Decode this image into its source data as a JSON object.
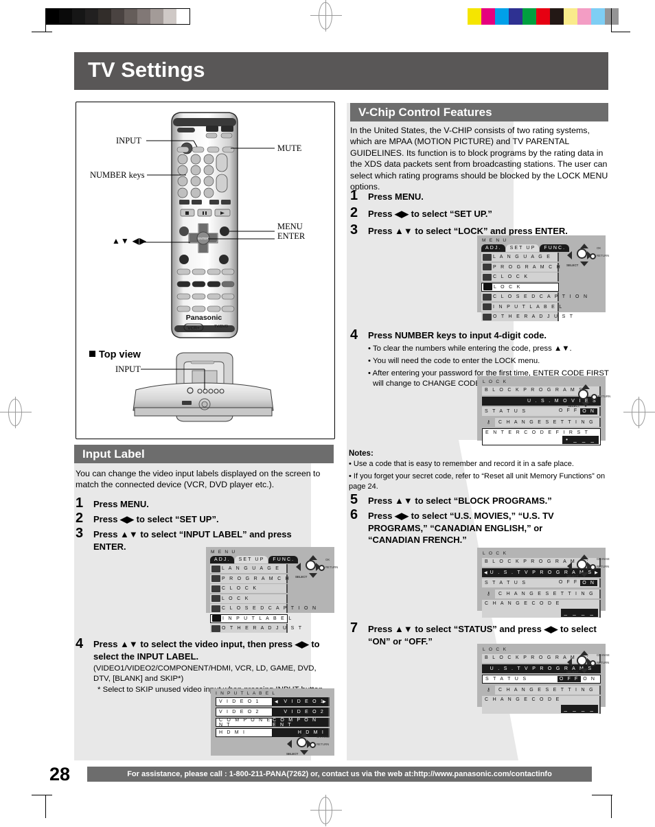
{
  "page": {
    "title": "TV Settings",
    "number": "28",
    "footer_text": "For assistance, please call : 1-800-211-PANA(7262) or, contact us via the web at:http://www.panasonic.com/contactinfo"
  },
  "colors": {
    "band_dark": "#595757",
    "band_gray": "#6d6d6d",
    "wash": "#e8e8e8",
    "osd_bg": "#b4b4b4"
  },
  "calibration": {
    "grayscale": [
      "#000000",
      "#0a0a0a",
      "#161616",
      "#222020",
      "#322d2a",
      "#4a4341",
      "#655d5a",
      "#817876",
      "#a39b98",
      "#cfc9c6",
      "#ffffff"
    ],
    "colorbar": [
      "#f5e500",
      "#e6007e",
      "#00a0e9",
      "#2e3192",
      "#00a040",
      "#e60012",
      "#231815",
      "#faeb8b",
      "#f39dc4",
      "#7ecef4",
      "#949495"
    ]
  },
  "remote_figure": {
    "labels": {
      "input": "INPUT",
      "number_keys": "NUMBER keys",
      "arrows": "▲▼ ◀▶",
      "mute": "MUTE",
      "menu": "MENU",
      "enter": "ENTER",
      "brand": "Panasonic",
      "vcr_plus": "VCR+",
      "tvdvd": "TV/DVD"
    },
    "topview": {
      "heading": "Top view",
      "input_label": "INPUT"
    }
  },
  "input_label_section": {
    "heading": "Input Label",
    "intro": "You can change the video input labels displayed on the screen to match the connected device (VCR, DVD player etc.).",
    "steps": [
      {
        "num": "1",
        "text": "Press MENU."
      },
      {
        "num": "2",
        "text": "Press ◀▶ to select “SET UP”."
      },
      {
        "num": "3",
        "text": "Press ▲▼ to select “INPUT LABEL” and press ENTER."
      },
      {
        "num": "4",
        "text": "Press ▲▼ to select the video input, then press ◀▶ to select the INPUT LABEL."
      }
    ],
    "step4_notes": [
      "(VIDEO1/VIDEO2/COMPONENT/HDMI, VCR, LD, GAME, DVD, DTV, [BLANK] and SKIP*)",
      "* Select to SKIP unused video input when pressing INPUT button."
    ]
  },
  "vchip_section": {
    "heading": "V-Chip Control Features",
    "intro": "In the United States, the V-CHIP consists of two rating systems, which are MPAA (MOTION PICTURE) and TV PARENTAL GUIDELINES. Its function is to block programs by the rating data in the XDS data packets sent from broadcasting stations. The user can select which rating programs should be blocked by the LOCK MENU options.",
    "steps": [
      {
        "num": "1",
        "text": "Press MENU."
      },
      {
        "num": "2",
        "text": "Press ◀▶ to select “SET UP.”"
      },
      {
        "num": "3",
        "text": "Press ▲▼ to select “LOCK” and press ENTER."
      },
      {
        "num": "4",
        "text": "Press NUMBER keys to input 4-digit code."
      },
      {
        "num": "5",
        "text": "Press ▲▼ to select “BLOCK PROGRAMS.”"
      },
      {
        "num": "6",
        "text": "Press ◀▶ to select “U.S. MOVIES,” “U.S. TV PROGRAMS,” “CANADIAN ENGLISH,” or “CANADIAN FRENCH.”"
      },
      {
        "num": "7",
        "text": "Press ▲▼ to select “STATUS” and press ◀▶ to select “ON” or “OFF.”"
      }
    ],
    "step4_bullets": [
      "• To clear the numbers while entering the code, press ▲▼.",
      "• You will need the code to enter the LOCK menu.",
      "• After entering your password for the first time, ENTER CODE FIRST will change to CHANGE CODE."
    ],
    "notes_heading": "Notes:",
    "notes": [
      "• Use a code that is easy to remember and record it in a safe place.",
      "• If you forget your secret code, refer to “Reset all unit Memory Functions” on page 24."
    ]
  },
  "osd_menu": {
    "header": "M E N U",
    "tabs": [
      {
        "label": "ADJ.",
        "state": "dark"
      },
      {
        "label": "SET UP",
        "state": "light"
      },
      {
        "label": "FUNC.",
        "state": "dark"
      }
    ],
    "items": [
      "L A N G U A G E",
      "P R O G R A M   C H",
      "C L O C K",
      "L O C K",
      "C L O S E D   C A P T I O N",
      "I N P U T   L A B E L",
      "O T H E R   A D J U S T"
    ],
    "selected_lock": "L O C K",
    "selected_input_label": "I N P U T   L A B E L"
  },
  "osd_lock_1": {
    "header": "L O C K",
    "block_programs_label": "B L O C K   P R O G R A M S :",
    "block_programs_value": "U . S .   M O V I E S",
    "status_label": "S T A T U S",
    "status_off": "O F F",
    "status_on": "O N",
    "change_setting": "C H A N G E   S E T T I N G",
    "code_caption": "E N T E R   C O D E   F I R S T",
    "code_digits": "• _  _  _"
  },
  "osd_lock_2": {
    "header": "L O C K",
    "block_programs_label": "B L O C K   P R O G R A M S :",
    "block_programs_value": "U . S .   T V   P R O G R A M S",
    "status_label": "S T A T U S",
    "status_off": "O F F",
    "status_on": "O N",
    "change_setting": "C H A N G E   S E T T I N G",
    "code_caption": "C H A N G E   C O D E",
    "code_digits": "_  _  _  _"
  },
  "osd_lock_3": {
    "header": "L O C K",
    "block_programs_label": "B L O C K   P R O G R A M S :",
    "block_programs_value": "U . S .   T V   P R O G R A M S",
    "status_label": "S T A T U S",
    "status_off": "O F F",
    "status_on": "O N",
    "change_setting": "C H A N G E   S E T T I N G",
    "code_caption": "C H A N G E   C O D E",
    "code_digits": "_  _  _  _"
  },
  "osd_input_label": {
    "header": "I N P U T   L A B E L",
    "rows": [
      {
        "name": "V I D E O 1",
        "value": "V I D E O 1",
        "selected": true
      },
      {
        "name": "V I D E O 2",
        "value": "V I D E O 2",
        "selected": false
      },
      {
        "name": "C O M P O N E N T",
        "value": "C O M P O N E N T",
        "selected": false
      },
      {
        "name": "H D M I",
        "value": "H D M I",
        "selected": false
      }
    ]
  },
  "navpad": {
    "ok": "OK",
    "page": "PAGE",
    "return": "RETURN",
    "change": "CHANGE",
    "select": "SELECT"
  }
}
